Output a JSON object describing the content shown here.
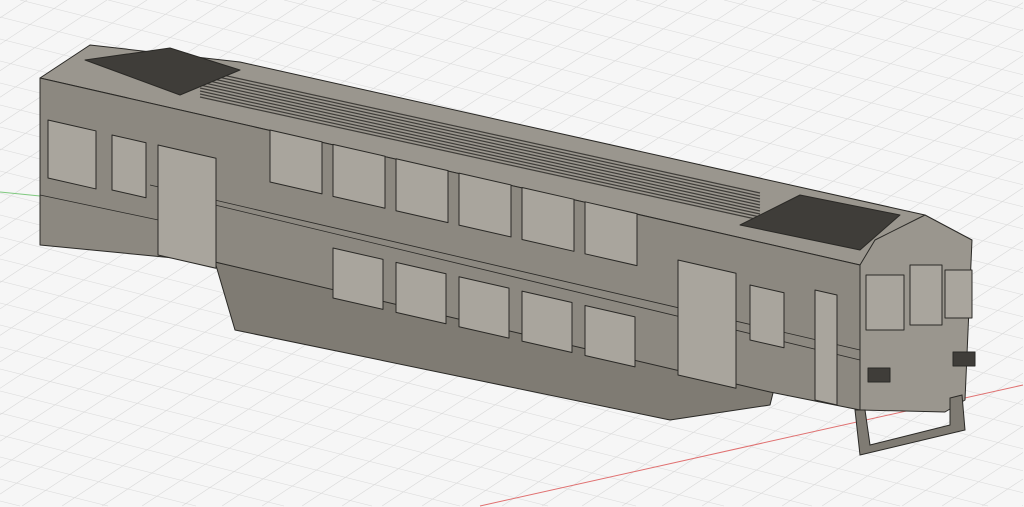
{
  "viewport": {
    "background": "#f6f6f6",
    "grid_color": "#d9d9d9",
    "x_axis_color": "#e07070",
    "y_axis_color": "#7fc97f"
  },
  "model": {
    "body_color": "#8c8880",
    "side_color": "#7f7b73",
    "roof_color": "#9a968e",
    "dark_color": "#3f3d39",
    "window_color": "#a9a59d",
    "edge_color": "#2a2926"
  }
}
